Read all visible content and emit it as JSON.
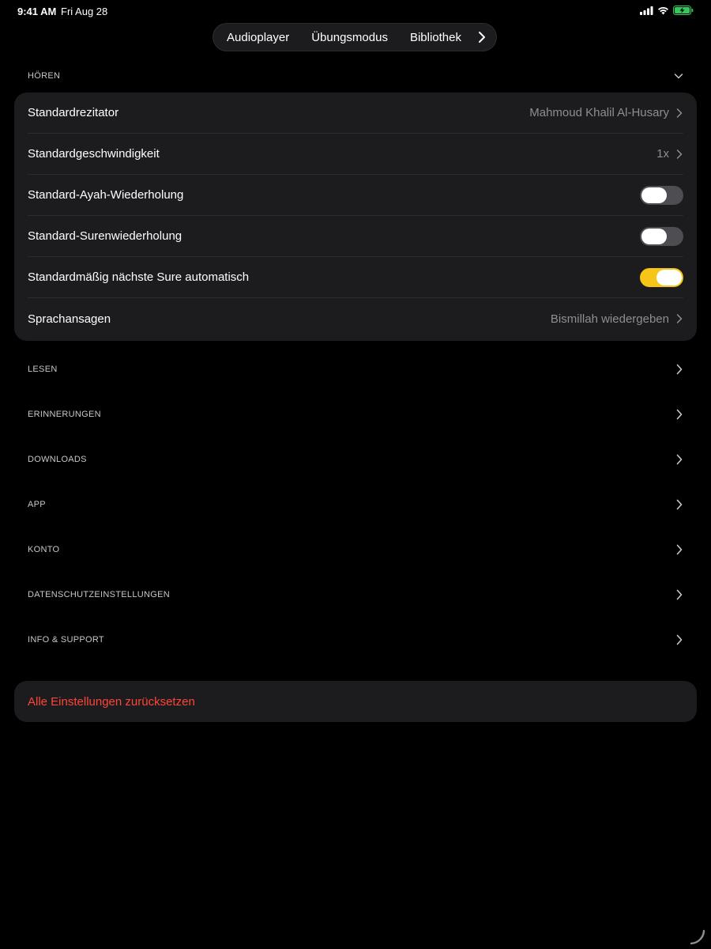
{
  "status_bar": {
    "time": "9:41 AM",
    "date": "Fri Aug 28"
  },
  "nav": {
    "items": [
      "Audioplayer",
      "Übungsmodus",
      "Bibliothek"
    ]
  },
  "listening": {
    "header": "HÖREN",
    "rows": [
      {
        "label": "Standardrezitator",
        "value": "Mahmoud Khalil Al-Husary"
      },
      {
        "label": "Standardgeschwindigkeit",
        "value": "1x"
      },
      {
        "label": "Standard-Ayah-Wiederholung",
        "toggle": false
      },
      {
        "label": "Standard-Surenwiederholung",
        "toggle": false
      },
      {
        "label": "Standardmäßig nächste Sure automatisch",
        "toggle": true
      },
      {
        "label": "Sprachansagen",
        "value": "Bismillah wiedergeben"
      }
    ]
  },
  "sections": [
    "LESEN",
    "ERINNERUNGEN",
    "DOWNLOADS",
    "APP",
    "KONTO",
    "DATENSCHUTZEINSTELLUNGEN",
    "INFO & SUPPORT"
  ],
  "reset": {
    "label": "Alle Einstellungen zurücksetzen"
  },
  "colors": {
    "accent_toggle": "#f5c518",
    "destructive": "#ff453a",
    "card": "#1c1c1e",
    "background": "#000000"
  }
}
